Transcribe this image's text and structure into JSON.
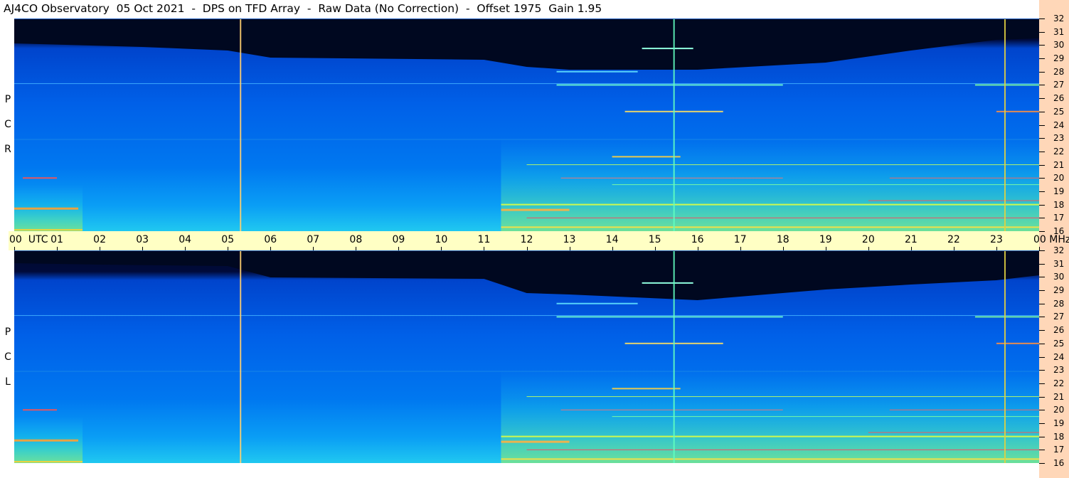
{
  "title": "AJ4CO Observatory  05 Oct 2021  -  DPS on TFD Array  -  Raw Data (No Correction)  -  Offset 1975  Gain 1.95",
  "chart_data": [
    {
      "type": "heatmap",
      "panel": "RCP",
      "ylabel": "R C P",
      "y_ticks": [
        "16",
        "17",
        "18",
        "19",
        "20",
        "21",
        "22",
        "23",
        "24",
        "25",
        "26",
        "27",
        "28",
        "29",
        "30",
        "31",
        "32"
      ],
      "ylim": [
        16,
        32
      ],
      "y_unit": "MHz",
      "xlim": [
        0,
        24
      ],
      "x_unit": "UTC"
    },
    {
      "type": "heatmap",
      "panel": "LCP",
      "ylabel": "L C P",
      "y_ticks": [
        "16",
        "17",
        "18",
        "19",
        "20",
        "21",
        "22",
        "23",
        "24",
        "25",
        "26",
        "27",
        "28",
        "29",
        "30",
        "31",
        "32"
      ],
      "ylim": [
        16,
        32
      ],
      "y_unit": "MHz",
      "xlim": [
        0,
        24
      ],
      "x_unit": "UTC"
    }
  ],
  "time_axis": {
    "ticks": [
      "00",
      "01",
      "02",
      "03",
      "04",
      "05",
      "06",
      "07",
      "08",
      "09",
      "10",
      "11",
      "12",
      "13",
      "14",
      "15",
      "16",
      "17",
      "18",
      "19",
      "20",
      "21",
      "22",
      "23",
      "00"
    ],
    "start_label": "00  UTC",
    "end_label": "00 MHz"
  },
  "colors": {
    "sky": "#000820",
    "background_blue": "#0055dd",
    "hot": "#ffee40",
    "strip": "#ffd7b8",
    "time_bar": "#ffffc4"
  }
}
